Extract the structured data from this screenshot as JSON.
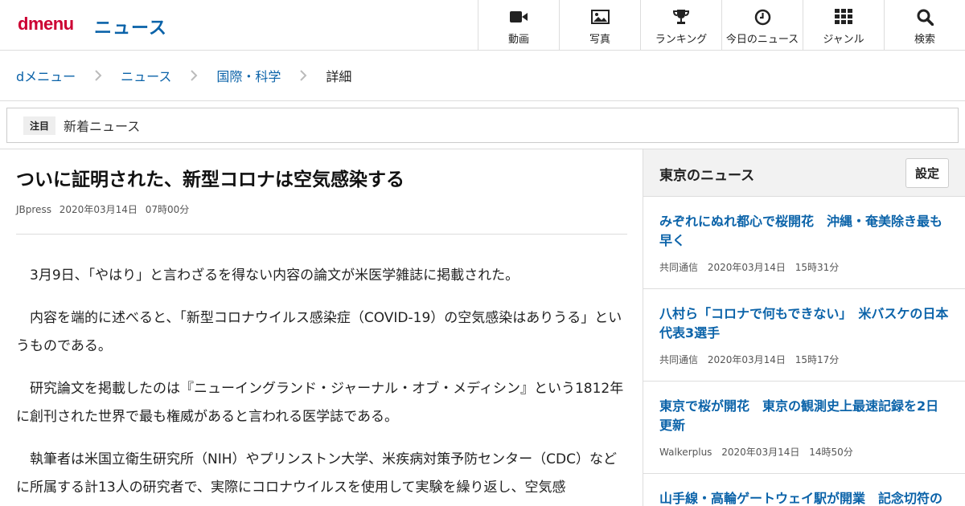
{
  "header": {
    "logo": "dmenu",
    "section_title": "ニュース",
    "nav": [
      {
        "label": "動画",
        "icon": "video-camera-icon"
      },
      {
        "label": "写真",
        "icon": "photo-icon"
      },
      {
        "label": "ランキング",
        "icon": "trophy-icon"
      },
      {
        "label": "今日のニュース",
        "icon": "clock-icon"
      },
      {
        "label": "ジャンル",
        "icon": "grid-icon"
      },
      {
        "label": "検索",
        "icon": "search-icon"
      }
    ]
  },
  "breadcrumb": {
    "items": [
      "dメニュー",
      "ニュース",
      "国際・科学",
      "詳細"
    ]
  },
  "attention": {
    "badge": "注目",
    "text": "新着ニュース"
  },
  "article": {
    "title": "ついに証明された、新型コロナは空気感染する",
    "source": "JBpress",
    "date": "2020年03月14日",
    "time": "07時00分",
    "paragraphs": [
      "3月9日、「やはり」と言わざるを得ない内容の論文が米医学雑誌に掲載された。",
      "内容を端的に述べると、「新型コロナウイルス感染症（COVID-19）の空気感染はありうる」というものである。",
      "研究論文を掲載したのは『ニューイングランド・ジャーナル・オブ・メディシン』という1812年に創刊された世界で最も権威があると言われる医学誌である。",
      "執筆者は米国立衛生研究所（NIH）やプリンストン大学、米疾病対策予防センター（CDC）などに所属する計13人の研究者で、実際にコロナウイルスを使用して実験を繰り返し、空気感"
    ]
  },
  "sidebar": {
    "title": "東京のニュース",
    "settings_label": "設定",
    "items": [
      {
        "title": "みぞれにぬれ都心で桜開花　沖縄・奄美除き最も早く",
        "source": "共同通信",
        "date": "2020年03月14日",
        "time": "15時31分"
      },
      {
        "title": "八村ら「コロナで何もできない」　米バスケの日本代表3選手",
        "source": "共同通信",
        "date": "2020年03月14日",
        "time": "15時17分"
      },
      {
        "title": "東京で桜が開花　東京の観測史上最速記録を2日更新",
        "source": "Walkerplus",
        "date": "2020年03月14日",
        "time": "14時50分"
      },
      {
        "title": "山手線・高輪ゲートウェイ駅が開業　記念切符の",
        "source": "",
        "date": "",
        "time": ""
      }
    ]
  },
  "colors": {
    "brand_red": "#cc0033",
    "link_blue": "#0b63a9"
  }
}
